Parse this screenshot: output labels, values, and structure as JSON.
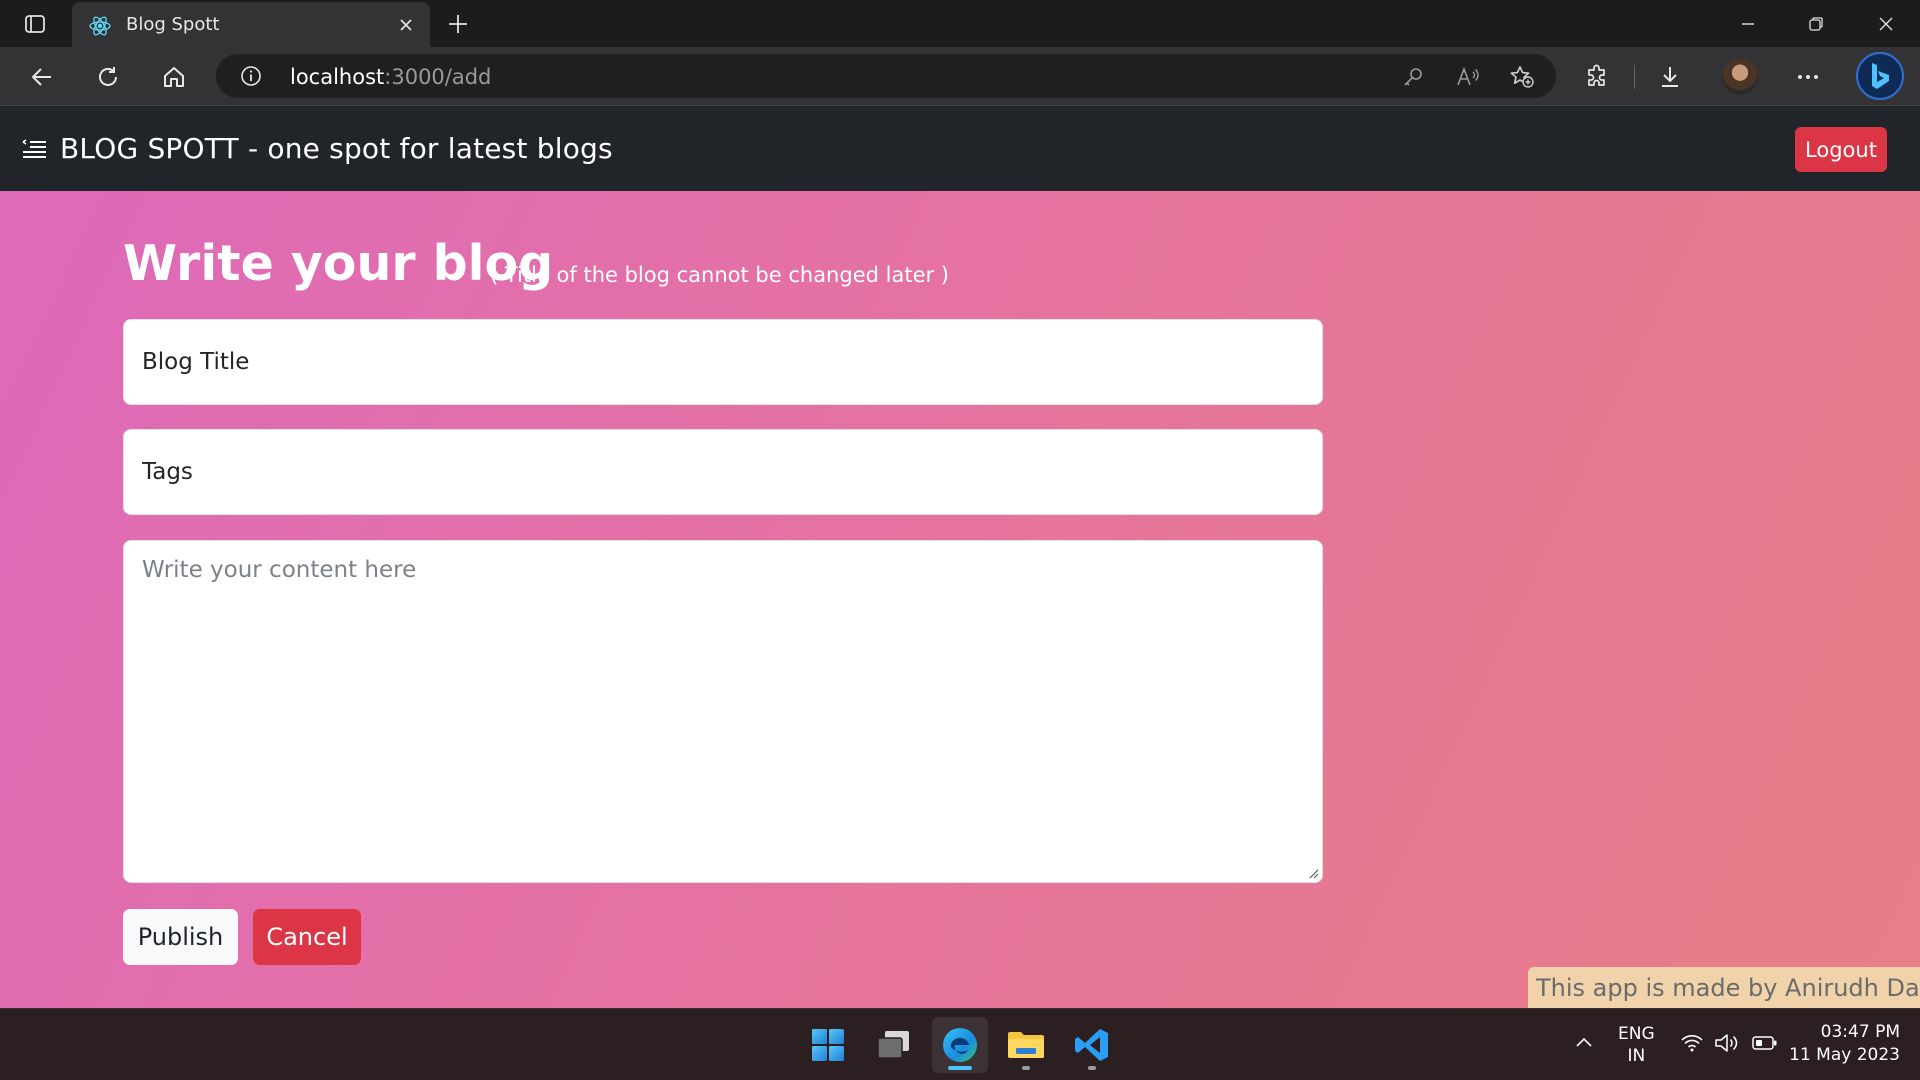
{
  "browser": {
    "tab": {
      "title": "Blog Spott"
    },
    "address": {
      "host": "localhost",
      "path": ":3000/add"
    }
  },
  "app": {
    "brand": "BLOG SPOTT - one spot for latest blogs",
    "logout_label": "Logout",
    "heading": "Write your blog",
    "heading_note": "( Title of the blog cannot be changed later )",
    "form": {
      "title_placeholder": "Blog Title",
      "tags_placeholder": "Tags",
      "content_placeholder": "Write your content here",
      "publish_label": "Publish",
      "cancel_label": "Cancel"
    },
    "footer_credit": "This app is made by Anirudh Dabral"
  },
  "taskbar": {
    "language_top": "ENG",
    "language_bottom": "IN",
    "time": "03:47 PM",
    "date": "11 May 2023"
  },
  "colors": {
    "nav_bg": "#212529",
    "danger": "#dc3545",
    "gradient_start": "#dd69bb",
    "gradient_end": "#e87e86",
    "credit_bg": "#f0d3aa"
  }
}
